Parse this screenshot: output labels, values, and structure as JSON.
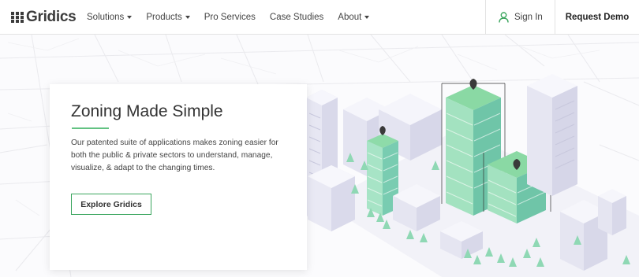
{
  "nav": {
    "logo": "Gridics",
    "menu": [
      {
        "label": "Solutions",
        "has_caret": true
      },
      {
        "label": "Products",
        "has_caret": true
      },
      {
        "label": "Pro Services",
        "has_caret": false
      },
      {
        "label": "Case Studies",
        "has_caret": false
      },
      {
        "label": "About",
        "has_caret": true
      }
    ],
    "sign_in": "Sign In",
    "request_demo": "Request Demo",
    "icons": {
      "sign_in": "user-icon",
      "menu_caret": "caret-down-icon"
    }
  },
  "hero": {
    "title": "Zoning Made Simple",
    "description": "Our patented suite of applications makes zoning easier for both the public & private sectors to understand, manage, visualize, & adapt to the changing times.",
    "cta": "Explore Gridics"
  },
  "colors": {
    "accent": "#3aa55d",
    "accent_light": "#7fd39b",
    "text": "#333333"
  }
}
